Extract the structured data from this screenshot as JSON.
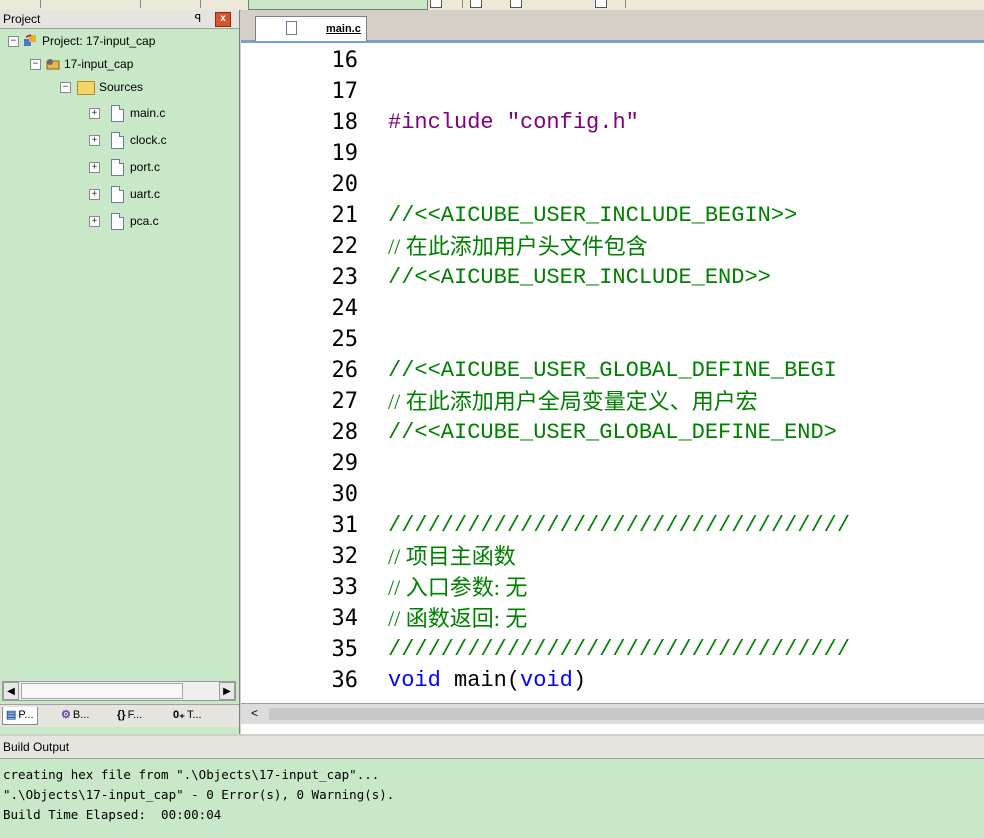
{
  "project_panel": {
    "title": "Project",
    "pin_glyph": "ꟼ",
    "close_glyph": "x",
    "tree": {
      "root": "Project: 17-input_cap",
      "target": "17-input_cap",
      "group": "Sources",
      "files": [
        "main.c",
        "clock.c",
        "port.c",
        "uart.c",
        "pca.c"
      ]
    },
    "tabs": [
      "P...",
      "B...",
      "F...",
      "T..."
    ],
    "tab_icons": [
      "▤",
      "⚙",
      "{}",
      "0₊"
    ]
  },
  "editor": {
    "active_tab": "main.c",
    "line_numbers": [
      "16",
      "17",
      "18",
      "19",
      "20",
      "21",
      "22",
      "23",
      "24",
      "25",
      "26",
      "27",
      "28",
      "29",
      "30",
      "31",
      "32",
      "33",
      "34",
      "35",
      "36"
    ],
    "lines": {
      "l18_directive": "#include",
      "l18_path": " \"config.h\"",
      "l21": "//<<AICUBE_USER_INCLUDE_BEGIN>>",
      "l22": "// 在此添加用户头文件包含",
      "l23": "//<<AICUBE_USER_INCLUDE_END>>",
      "l26": "//<<AICUBE_USER_GLOBAL_DEFINE_BEGI",
      "l27": "// 在此添加用户全局变量定义、用户宏",
      "l28": "//<<AICUBE_USER_GLOBAL_DEFINE_END>",
      "l31": "///////////////////////////////////",
      "l32": "// 项目主函数",
      "l33": "// 入口参数: 无",
      "l34": "// 函数返回: 无",
      "l35": "///////////////////////////////////",
      "l36_kw1": "void",
      "l36_mid": " main(",
      "l36_kw2": "void",
      "l36_end": ")"
    },
    "scroll_left_glyph": "<"
  },
  "build_output": {
    "title": "Build Output",
    "lines": [
      "creating hex file from \".\\Objects\\17-input_cap\"...",
      "\".\\Objects\\17-input_cap\" - 0 Error(s), 0 Warning(s).",
      "Build Time Elapsed:  00:00:04"
    ]
  },
  "colors": {
    "panel_bg": "#c8e8c8",
    "comment": "#008000",
    "keyword": "#0000ff",
    "close_button": "#d9532c"
  }
}
